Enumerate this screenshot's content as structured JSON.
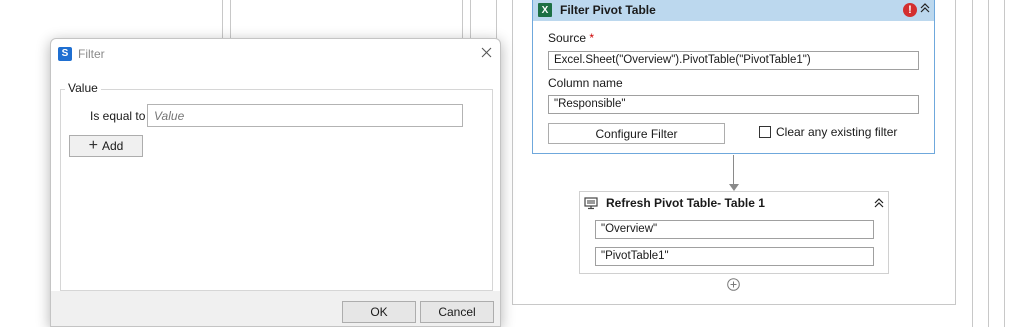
{
  "filter_pivot_table": {
    "title": "Filter Pivot Table",
    "icon": "excel-icon",
    "source_label": "Source",
    "source_required_mark": "*",
    "source_value": "Excel.Sheet(\"Overview\").PivotTable(\"PivotTable1\")",
    "column_name_label": "Column name",
    "column_name_value": "\"Responsible\"",
    "configure_filter_label": "Configure Filter",
    "clear_filter_label": "Clear any existing filter",
    "clear_filter_checked": false,
    "error_icon": "error-icon",
    "header_color": "#bcd8ee"
  },
  "refresh_pivot_table": {
    "title": "Refresh Pivot Table- Table 1",
    "icon": "monitor-icon",
    "sheet_value": "\"Overview\"",
    "table_value": "\"PivotTable1\""
  },
  "filter_dialog": {
    "title": "Filter",
    "group_label": "Value",
    "condition_label": "Is equal to",
    "value_placeholder": "Value",
    "value_current": "",
    "add_button_label": "Add",
    "ok_button_label": "OK",
    "cancel_button_label": "Cancel"
  }
}
